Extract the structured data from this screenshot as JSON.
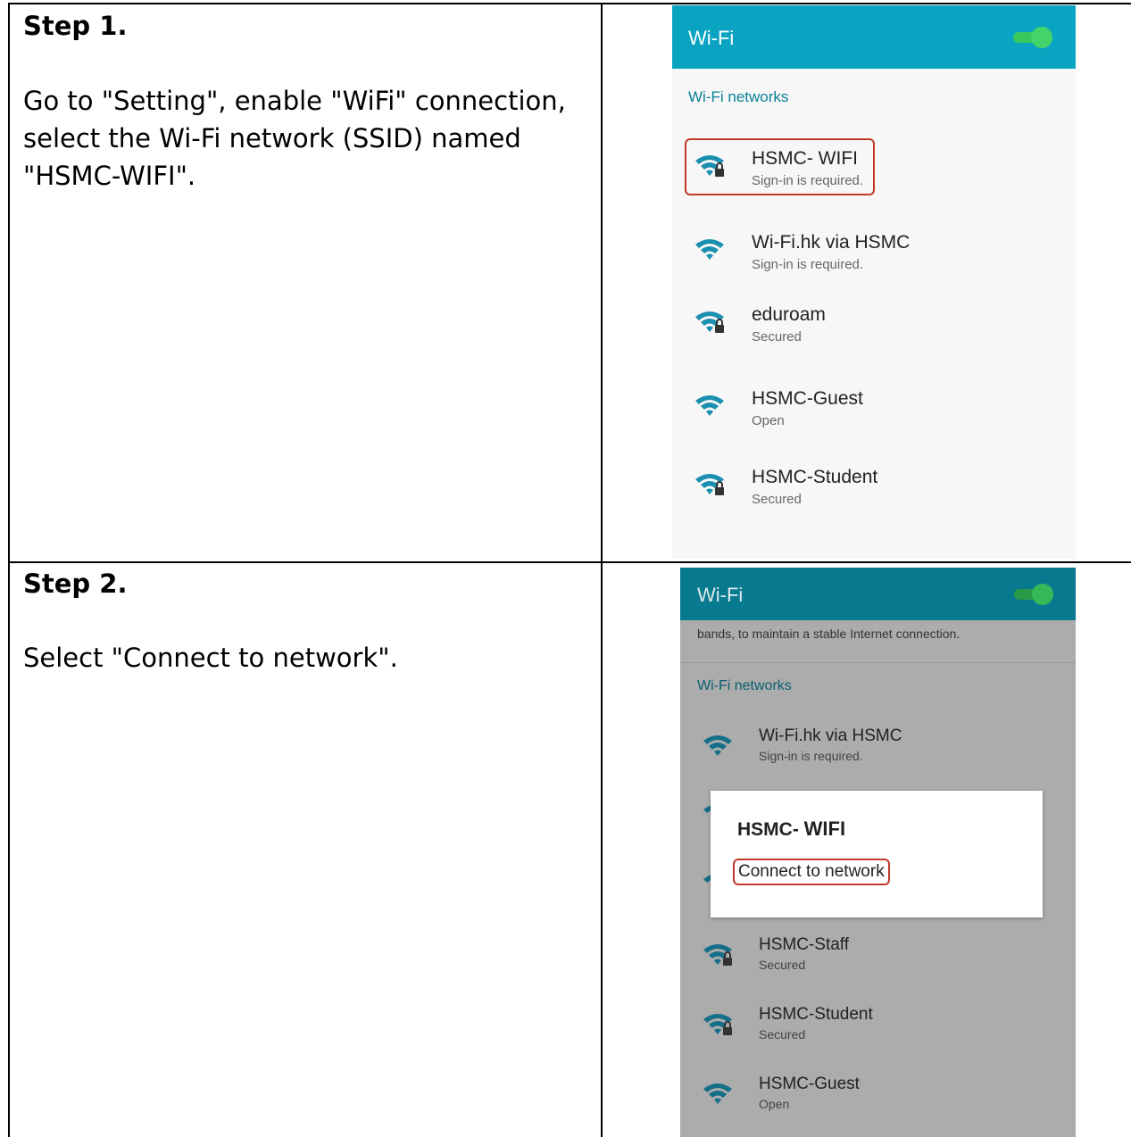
{
  "step1": {
    "title": "Step 1.",
    "text": "Go to \"Setting\", enable \"WiFi\" connection,  select the Wi-Fi network (SSID) named \"HSMC-WIFI\".",
    "screen": {
      "appbar_title": "Wi-Fi",
      "wifi_toggle_on": true,
      "section_label": "Wi-Fi networks",
      "networks": [
        {
          "name": "HSMC- WIFI",
          "status": "Sign-in is required.",
          "icon": "wifi-locked-icon",
          "highlighted": true
        },
        {
          "name": "Wi-Fi.hk via HSMC",
          "status": "Sign-in is required.",
          "icon": "wifi-icon"
        },
        {
          "name": "eduroam",
          "status": "Secured",
          "icon": "wifi-locked-icon"
        },
        {
          "name": "HSMC-Guest",
          "status": "Open",
          "icon": "wifi-icon"
        },
        {
          "name": "HSMC-Student",
          "status": "Secured",
          "icon": "wifi-locked-icon"
        }
      ]
    }
  },
  "step2": {
    "title": "Step 2.",
    "text": "Select \"Connect to network\".",
    "screen": {
      "appbar_title": "Wi-Fi",
      "wifi_toggle_on": true,
      "partial_text": "bands, to maintain a stable Internet connection.",
      "section_label": "Wi-Fi networks",
      "networks": [
        {
          "name": "Wi-Fi.hk via HSMC",
          "status": "Sign-in is required.",
          "icon": "wifi-icon"
        },
        {
          "name": "HSMC-Staff",
          "status": "Secured",
          "icon": "wifi-locked-icon"
        },
        {
          "name": "HSMC-Student",
          "status": "Secured",
          "icon": "wifi-locked-icon"
        },
        {
          "name": "HSMC-Guest",
          "status": "Open",
          "icon": "wifi-icon"
        }
      ],
      "dialog": {
        "title_prefix": "HSMC- ",
        "title_bold": "WIFI",
        "option": "Connect to network"
      }
    }
  },
  "colors": {
    "appbar_step1": "#0aa3c2",
    "appbar_step2": "#087a8f",
    "toggle": "#44d36a",
    "wifi_icon": "#1a8fb0",
    "highlight_border": "#c0392b",
    "dim_background": "#acacac"
  }
}
